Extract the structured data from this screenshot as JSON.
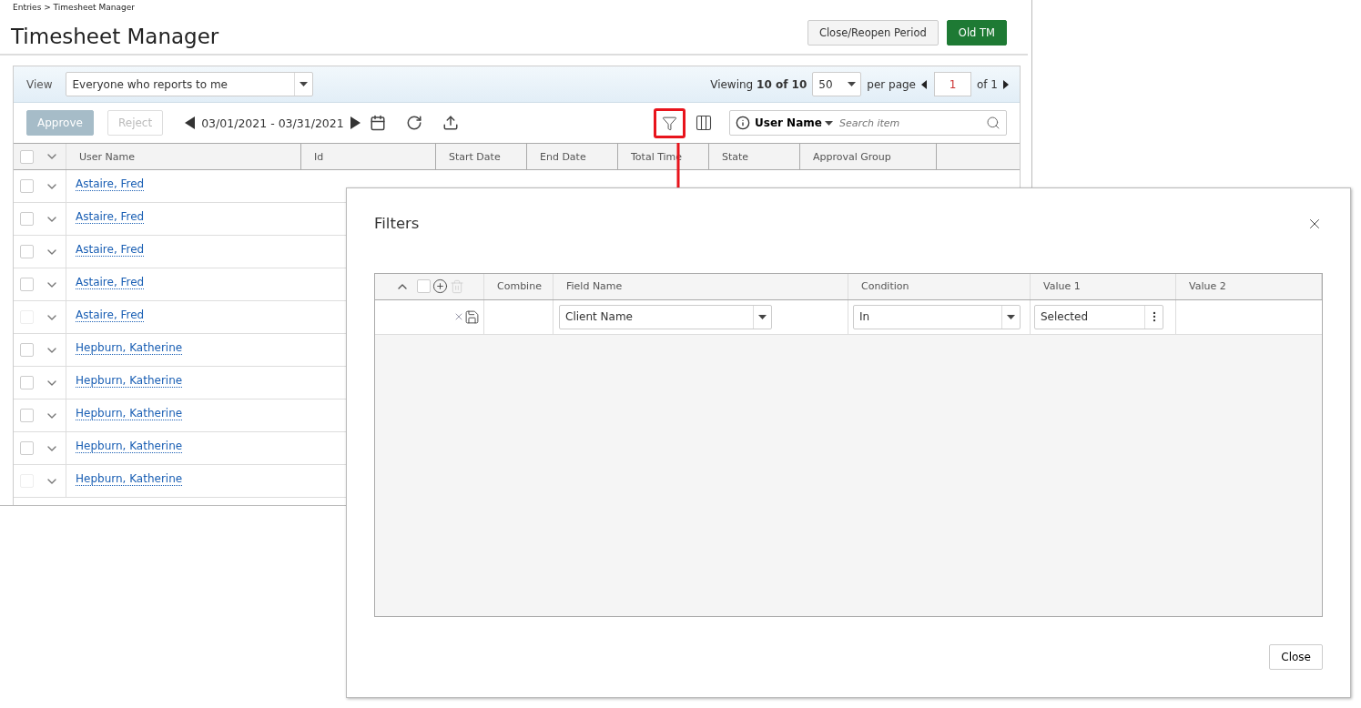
{
  "breadcrumb": "Entries > Timesheet Manager",
  "title": "Timesheet Manager",
  "header_buttons": [
    {
      "label": "Close/Reopen Period",
      "kind": "secondary"
    },
    {
      "label": "Old TM",
      "kind": "primary"
    }
  ],
  "view": {
    "label": "View",
    "value": "Everyone who reports to me"
  },
  "paging": {
    "viewing": "Viewing **10 of 10**",
    "per_page_value": "50",
    "per_page_label": "per page",
    "page": "1",
    "of_pages": "of 1"
  },
  "toolbar": {
    "approve": {
      "label": "Approve",
      "disabled": true
    },
    "reject": {
      "label": "Reject",
      "disabled": true
    },
    "date_range": "03/01/2021 - 03/31/2021",
    "filter_highlighted": true
  },
  "search": {
    "field": "User Name",
    "placeholder": "Search item"
  },
  "select_all_checked": false,
  "columns": [
    "User Name",
    "Id",
    "Start Date",
    "End Date",
    "Total Time",
    "State",
    "Approval Group"
  ],
  "rows": [
    {
      "user": "Astaire, Fred",
      "checkbox_disabled": false
    },
    {
      "user": "Astaire, Fred",
      "checkbox_disabled": false
    },
    {
      "user": "Astaire, Fred",
      "checkbox_disabled": false
    },
    {
      "user": "Astaire, Fred",
      "checkbox_disabled": false
    },
    {
      "user": "Astaire, Fred",
      "checkbox_disabled": true
    },
    {
      "user": "Hepburn, Katherine",
      "checkbox_disabled": false
    },
    {
      "user": "Hepburn, Katherine",
      "checkbox_disabled": false
    },
    {
      "user": "Hepburn, Katherine",
      "checkbox_disabled": false
    },
    {
      "user": "Hepburn, Katherine",
      "checkbox_disabled": false
    },
    {
      "user": "Hepburn, Katherine",
      "checkbox_disabled": true
    }
  ],
  "dialog": {
    "title": "Filters",
    "select_all_checked": false,
    "columns": [
      "Combine",
      "Field Name",
      "Condition",
      "Value 1",
      "Value 2"
    ],
    "filters": [
      {
        "field": "Client Name",
        "condition": "In",
        "value1": "Selected"
      }
    ],
    "close_label": "Close"
  }
}
